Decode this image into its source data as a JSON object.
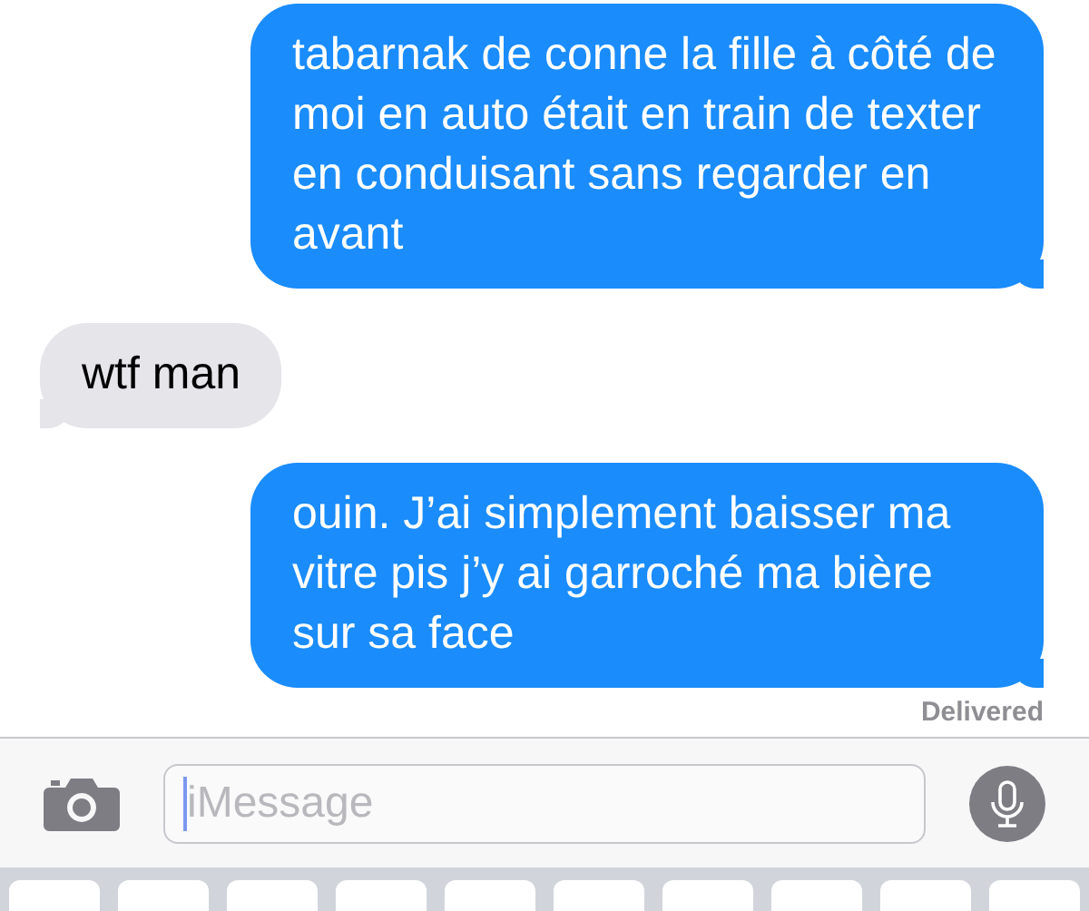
{
  "messages": [
    {
      "kind": "sent",
      "text": "tabarnak de conne la fille à côté de moi en auto était en train de texter en conduisant sans regarder en avant"
    },
    {
      "kind": "received",
      "text": "wtf man"
    },
    {
      "kind": "sent",
      "text": "ouin. J’ai simplement baisser ma vitre pis j’y ai garroché ma bière sur sa face"
    }
  ],
  "status": "Delivered",
  "compose": {
    "placeholder": "iMessage"
  }
}
